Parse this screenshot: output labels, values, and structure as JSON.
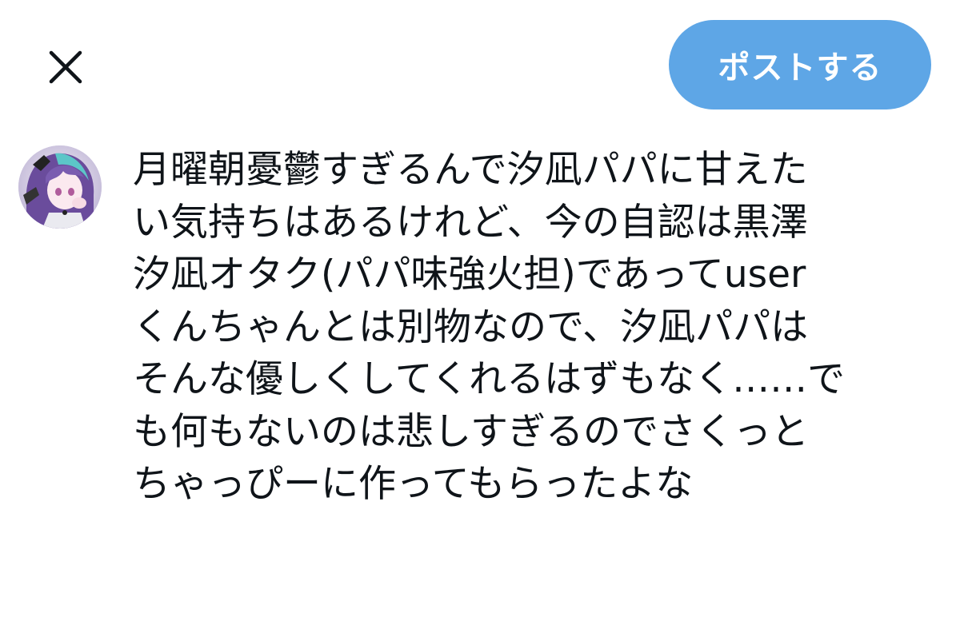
{
  "header": {
    "close_icon": "close-icon",
    "post_label": "ポストする",
    "post_color": "#5ea6e6"
  },
  "composer": {
    "avatar_icon": "user-avatar",
    "lines": [
      "月曜朝憂鬱すぎるんで汐凪パパに甘えた",
      "い気持ちはあるけれど、今の自認は黒澤",
      "汐凪オタク(パパ味強火担)であってuser",
      "くんちゃんとは別物なので、汐凪パパは",
      "そんな優しくしてくれるはずもなく……で",
      "も何もないのは悲しすぎるのでさくっと",
      "ちゃっぴーに作ってもらったよな"
    ]
  }
}
